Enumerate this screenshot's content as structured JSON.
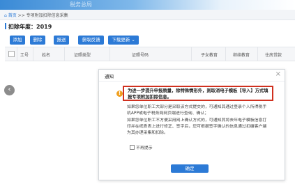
{
  "header": {
    "watermark_text": "税务总局"
  },
  "breadcrumb": {
    "home": "首页",
    "separator": ">>",
    "current": "专项附加扣除信息采集"
  },
  "deduction_year": {
    "label": "扣除年度：",
    "value": "2019"
  },
  "toolbar": {
    "buttons": [
      {
        "label": "添加"
      },
      {
        "label": "删除"
      },
      {
        "label": "报送"
      },
      {
        "label": "获取反馈"
      },
      {
        "label": "下载更新",
        "caret": "⌄"
      }
    ]
  },
  "table": {
    "columns": [
      "工号",
      "姓名",
      "证照类型",
      "证照号码",
      "子女教育",
      "继续教育",
      "住房贷款"
    ]
  },
  "modal": {
    "title": "通知",
    "close_symbol": "×",
    "warning_icon": "!",
    "highlight_text": "为进一步提升申报质量，除特殊情形外，则取消电子模板【导入】方式填报专项附加扣除信息。",
    "paragraph1": "如果您单位职工大部分是采取该方式提交的，可通知其通过登录个人所得税手机APP或电子税务局网页端进行查询、确认；",
    "paragraph2": "如果您单位职工不方便采用网上确认方式的，可通知其将去年电子模板信息打印并在纸质表上进行修正、签字后，您可根据签字确认的信息通过扣缴客户端为其办理采集和扣除。",
    "no_more_label": "不再提示",
    "confirm_label": "确定"
  },
  "nav": {
    "prev_arrow": "‹"
  },
  "colors": {
    "accent": "#2c7ad6",
    "highlight_border": "#d0301f",
    "warning": "#f0a020"
  }
}
